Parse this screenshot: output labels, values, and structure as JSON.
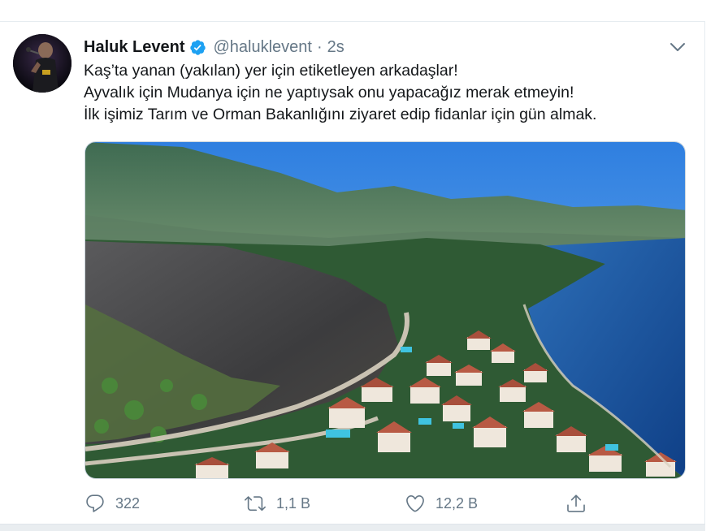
{
  "tweet": {
    "display_name": "Haluk Levent",
    "handle": "@haluklevent",
    "separator": "·",
    "time": "2s",
    "text_lines": [
      "Kaş’ta yanan (yakılan) yer için etiketleyen arkadaşlar!",
      "Ayvalık için Mudanya için ne yaptıysak onu yapacağız merak etmeyin!",
      "İlk işimiz Tarım ve Orman Bakanlığını ziyaret edip fidanlar için gün almak."
    ]
  },
  "actions": {
    "replies": "322",
    "retweets": "1,1 B",
    "likes": "12,2 B"
  },
  "icons": {
    "verified": "verified-badge-icon",
    "caret": "chevron-down-icon",
    "reply": "reply-icon",
    "retweet": "retweet-icon",
    "like": "heart-icon",
    "share": "share-icon"
  },
  "colors": {
    "verified": "#1da1f2",
    "text": "#14171a",
    "muted": "#657786"
  }
}
